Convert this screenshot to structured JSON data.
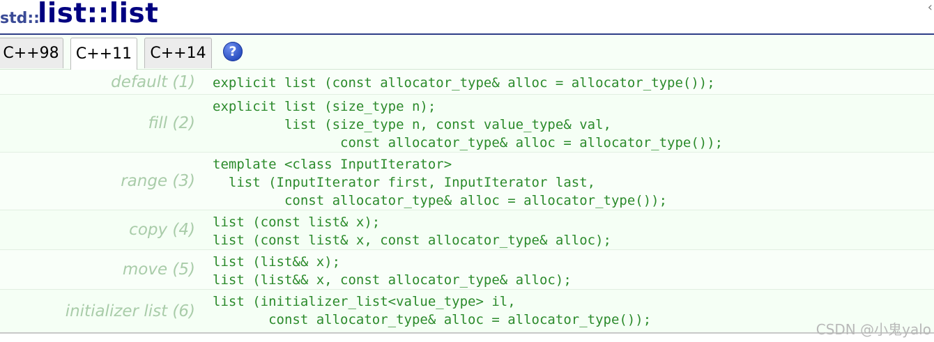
{
  "title": {
    "namespace": "std::",
    "name": "list::list",
    "corner_icon": "‹"
  },
  "tabs": [
    {
      "label": "C++98",
      "active": false
    },
    {
      "label": "C++11",
      "active": true
    },
    {
      "label": "C++14",
      "active": false
    }
  ],
  "help_icon": {
    "symbol": "?",
    "name": "help-icon"
  },
  "constructors": [
    {
      "label": "default (1)",
      "code": "explicit list (const allocator_type& alloc = allocator_type());"
    },
    {
      "label": "fill (2)",
      "code": "explicit list (size_type n);\n         list (size_type n, const value_type& val,\n                const allocator_type& alloc = allocator_type());"
    },
    {
      "label": "range (3)",
      "code": "template <class InputIterator>\n  list (InputIterator first, InputIterator last,\n         const allocator_type& alloc = allocator_type());"
    },
    {
      "label": "copy (4)",
      "code": "list (const list& x);\nlist (const list& x, const allocator_type& alloc);"
    },
    {
      "label": "move (5)",
      "code": "list (list&& x);\nlist (list&& x, const allocator_type& alloc);"
    },
    {
      "label": "initializer list (6)",
      "code": "list (initializer_list<value_type> il,\n       const allocator_type& alloc = allocator_type());"
    }
  ],
  "watermark": "CSDN @小鬼yalo"
}
